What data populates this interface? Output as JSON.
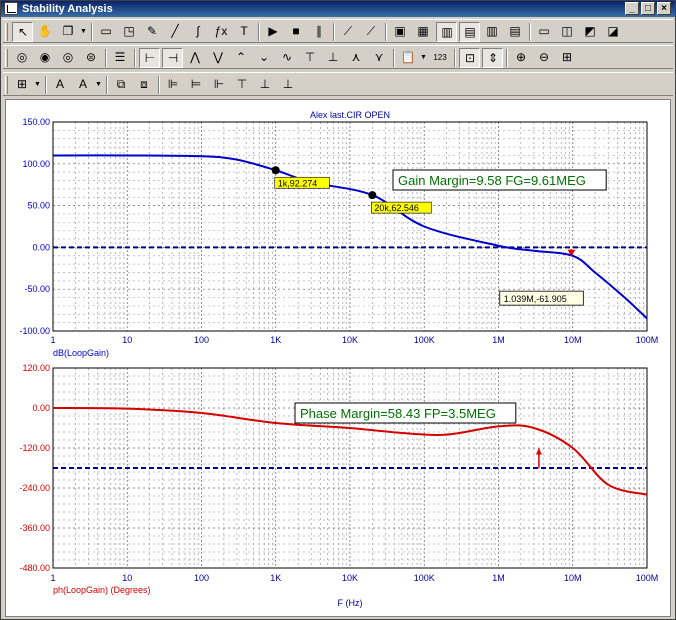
{
  "window": {
    "title": "Stability Analysis",
    "minimize": "_",
    "maximize": "□",
    "close": "×"
  },
  "toolbar1": [
    {
      "icon": "pointer-arrow-icon",
      "glyph": "↖"
    },
    {
      "icon": "hand-pan-icon",
      "glyph": "✋"
    },
    {
      "icon": "copy-dropdown-icon",
      "glyph": "❐"
    },
    {
      "icon": "image-icon",
      "glyph": "▭"
    },
    {
      "icon": "zoom-window-icon",
      "glyph": "◳"
    },
    {
      "icon": "edit-graph-icon",
      "glyph": "✎"
    },
    {
      "icon": "line-draw-icon",
      "glyph": "╱"
    },
    {
      "icon": "curve-draw-icon",
      "glyph": "∫"
    },
    {
      "icon": "function-icon",
      "glyph": "ƒx"
    },
    {
      "icon": "text-tool-icon",
      "glyph": "T"
    },
    {
      "icon": "run-icon",
      "glyph": "▶"
    },
    {
      "icon": "stop-icon",
      "glyph": "■"
    },
    {
      "icon": "pause-icon",
      "glyph": "∥"
    },
    {
      "icon": "cursor-tangent-icon",
      "glyph": "⟋"
    },
    {
      "icon": "cursor-slope-icon",
      "glyph": "⟋"
    },
    {
      "icon": "stack-windows-icon",
      "glyph": "▣"
    },
    {
      "icon": "tile-windows-icon",
      "glyph": "▦"
    },
    {
      "icon": "layout-1-icon",
      "glyph": "▥"
    },
    {
      "icon": "layout-2-icon",
      "glyph": "▤"
    },
    {
      "icon": "layout-3-icon",
      "glyph": "▥"
    },
    {
      "icon": "layout-4-icon",
      "glyph": "▤"
    },
    {
      "icon": "split-h-icon",
      "glyph": "▭"
    },
    {
      "icon": "split-v-icon",
      "glyph": "◫"
    },
    {
      "icon": "graph-window-icon",
      "glyph": "◩"
    },
    {
      "icon": "export-graph-icon",
      "glyph": "◪"
    }
  ],
  "toolbar2": [
    {
      "icon": "zoom-fit-icon",
      "glyph": "◎"
    },
    {
      "icon": "zoom-prev-icon",
      "glyph": "◉"
    },
    {
      "icon": "zoom-reset-icon",
      "glyph": "◎"
    },
    {
      "icon": "color-palette-icon",
      "glyph": "⊜"
    },
    {
      "icon": "properties-icon",
      "glyph": "☰"
    },
    {
      "icon": "cursor-left-icon",
      "glyph": "⊢"
    },
    {
      "icon": "cursor-right-icon",
      "glyph": "⊣"
    },
    {
      "icon": "peak-icon",
      "glyph": "⋀"
    },
    {
      "icon": "valley-icon",
      "glyph": "⋁"
    },
    {
      "icon": "high-icon",
      "glyph": "⌃"
    },
    {
      "icon": "low-icon",
      "glyph": "⌄"
    },
    {
      "icon": "inflection-icon",
      "glyph": "∿"
    },
    {
      "icon": "global-high-icon",
      "glyph": "⊤"
    },
    {
      "icon": "global-low-icon",
      "glyph": "⊥"
    },
    {
      "icon": "local-high-icon",
      "glyph": "⋏"
    },
    {
      "icon": "local-low-icon",
      "glyph": "⋎"
    },
    {
      "icon": "clipboard-icon",
      "glyph": "📋"
    },
    {
      "icon": "data-points-icon",
      "glyph": "123"
    },
    {
      "icon": "fit-window-icon",
      "glyph": "⊡"
    },
    {
      "icon": "fit-height-icon",
      "glyph": "⇕"
    },
    {
      "icon": "zoom-in-icon",
      "glyph": "⊕"
    },
    {
      "icon": "zoom-out-icon",
      "glyph": "⊖"
    },
    {
      "icon": "zoom-preset-icon",
      "glyph": "⊞"
    }
  ],
  "toolbar3": [
    {
      "icon": "grid-icon",
      "glyph": "⊞"
    },
    {
      "icon": "font-icon",
      "glyph": "A"
    },
    {
      "icon": "text-color-icon",
      "glyph": "A"
    },
    {
      "icon": "bring-front-icon",
      "glyph": "⧉"
    },
    {
      "icon": "send-back-icon",
      "glyph": "⧈"
    },
    {
      "icon": "align-left-icon",
      "glyph": "⊫"
    },
    {
      "icon": "align-center-icon",
      "glyph": "⊨"
    },
    {
      "icon": "align-right-icon",
      "glyph": "⊩"
    },
    {
      "icon": "align-top-icon",
      "glyph": "⊤"
    },
    {
      "icon": "align-middle-icon",
      "glyph": "⊥"
    },
    {
      "icon": "align-bottom-icon",
      "glyph": "⊥"
    }
  ],
  "chart_data": [
    {
      "type": "line",
      "title": "Alex last.CIR OPEN",
      "ylabel": "dB(LoopGain)",
      "xscale": "log",
      "xlim": [
        1,
        100000000
      ],
      "ylim": [
        -100,
        150
      ],
      "yticks": [
        "150.00",
        "100.00",
        "50.00",
        "0.00",
        "-50.00",
        "-100.00"
      ],
      "xticks": [
        "1",
        "10",
        "100",
        "1K",
        "10K",
        "100K",
        "1M",
        "10M",
        "100M"
      ],
      "grid": true,
      "series": [
        {
          "color": "#0000cc",
          "x": [
            1,
            10,
            100,
            300,
            1000,
            3000,
            20000,
            100000,
            1000000,
            3000000,
            10000000,
            20000000,
            50000000,
            100000000
          ],
          "y": [
            110,
            110,
            109,
            105,
            92.274,
            78,
            62.546,
            25,
            2,
            -4,
            -10,
            -30,
            -60,
            -85
          ]
        }
      ],
      "reference": {
        "y": 0,
        "color": "#00008b"
      },
      "markers": [
        {
          "x": 1000,
          "y": 92.274,
          "label": "1k,92.274"
        },
        {
          "x": 20000,
          "y": 62.546,
          "label": "20k,62.546"
        }
      ],
      "point_label": {
        "x": 1039000,
        "y": -61.905,
        "label": "1.039M,-61.905"
      },
      "margin_text": "Gain Margin=9.58 FG=9.61MEG",
      "margin_arrow": {
        "x": 9610000,
        "from": -2,
        "to": -10
      }
    },
    {
      "type": "line",
      "ylabel": "ph(LoopGain) (Degrees)",
      "xlabel": "F (Hz)",
      "xscale": "log",
      "xlim": [
        1,
        100000000
      ],
      "ylim": [
        -480,
        120
      ],
      "yticks": [
        "120.00",
        "0.00",
        "-120.00",
        "-240.00",
        "-360.00",
        "-480.00"
      ],
      "xticks": [
        "1",
        "10",
        "100",
        "1K",
        "10K",
        "100K",
        "1M",
        "10M",
        "100M"
      ],
      "grid": true,
      "series": [
        {
          "color": "#d40000",
          "x": [
            1,
            10,
            100,
            1000,
            10000,
            50000,
            200000,
            1000000,
            3000000,
            10000000,
            30000000,
            100000000
          ],
          "y": [
            0,
            -2,
            -15,
            -45,
            -60,
            -75,
            -80,
            -55,
            -60,
            -120,
            -230,
            -260
          ]
        }
      ],
      "reference": {
        "y": -180,
        "color": "#00008b"
      },
      "margin_text": "Phase Margin=58.43 FP=3.5MEG",
      "margin_arrow": {
        "x": 3500000,
        "from": -180,
        "to": -121.57
      }
    }
  ]
}
